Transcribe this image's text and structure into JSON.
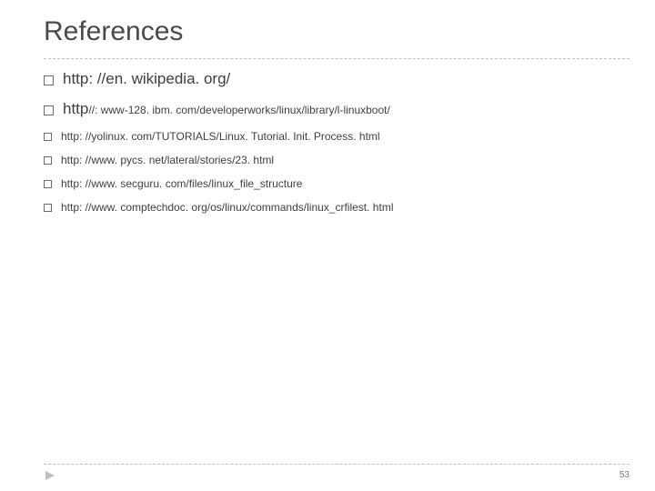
{
  "title": "References",
  "references": [
    {
      "prefix": "http: //en. wikipedia. org/",
      "rest": "",
      "large": true
    },
    {
      "prefix": "http",
      "rest": "//: www-128. ibm. com/developerworks/linux/library/l-linuxboot/",
      "large": true
    },
    {
      "prefix": "",
      "rest": "http: //yolinux. com/TUTORIALS/Linux. Tutorial. Init. Process. html",
      "large": false
    },
    {
      "prefix": "",
      "rest": "http: //www. pycs. net/lateral/stories/23. html",
      "large": false
    },
    {
      "prefix": "",
      "rest": "http: //www. secguru. com/files/linux_file_structure",
      "large": false
    },
    {
      "prefix": "",
      "rest": "http: //www. comptechdoc. org/os/linux/commands/linux_crfilest. html",
      "large": false
    }
  ],
  "page_number": "53"
}
